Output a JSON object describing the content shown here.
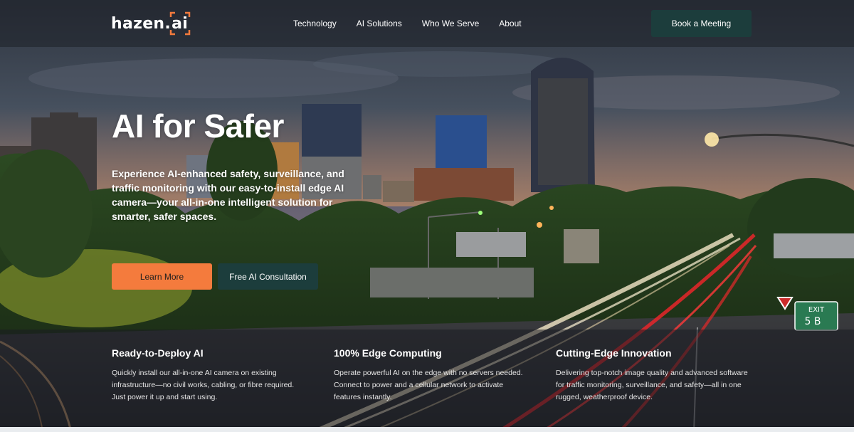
{
  "nav": {
    "logo": {
      "text": "hazen",
      "dot": ".",
      "suffix": "ai",
      "accent": "#f47b3d"
    },
    "links": [
      "Technology",
      "AI Solutions",
      "Who We Serve",
      "About"
    ],
    "cta": "Book a Meeting"
  },
  "hero": {
    "title": "AI for Safer",
    "description": "Experience AI-enhanced safety, surveillance, and traffic monitoring with our easy-to-install edge AI camera—your all-in-one intelligent solution for smarter, safer spaces.",
    "primary_button": "Learn More",
    "secondary_button": "Free AI Consultation"
  },
  "features": [
    {
      "title": "Ready-to-Deploy AI",
      "text": "Quickly install our all-in-one AI camera on existing infrastructure—no civil works, cabling, or fibre required. Just power it up and start using."
    },
    {
      "title": "100% Edge Computing",
      "text": "Operate powerful AI on the edge with no servers needed. Connect to power and a cellular network to activate features instantly."
    },
    {
      "title": "Cutting-Edge Innovation",
      "text": "Delivering top-notch image quality and advanced software for traffic monitoring, surveillance, and safety—all in one rugged, weatherproof device."
    }
  ],
  "colors": {
    "accent_orange": "#f47b3d",
    "dark_teal": "#1c3d3c"
  }
}
